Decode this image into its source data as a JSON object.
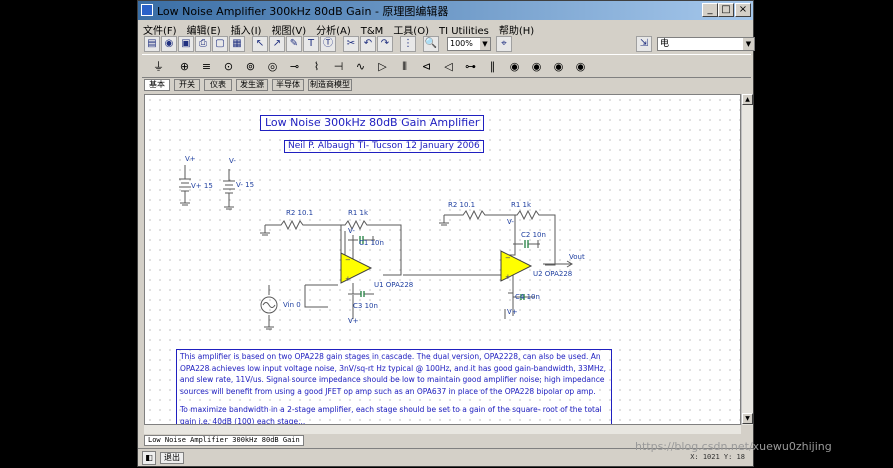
{
  "window": {
    "title": "Low Noise Amplifier 300kHz 80dB Gain - 原理图编辑器",
    "controls": {
      "minimize": "_",
      "maximize": "□",
      "close": "×"
    }
  },
  "menu": [
    "文件(F)",
    "编辑(E)",
    "插入(I)",
    "视图(V)",
    "分析(A)",
    "T&M",
    "工具(O)",
    "TI Utilities",
    "帮助(H)"
  ],
  "toolbar": {
    "zoom": "100%",
    "component_combo": "电"
  },
  "component_tabs": [
    "基本",
    "开关",
    "仪表",
    "发生源",
    "半导体",
    "制造商模型"
  ],
  "active_tab_index": 0,
  "schematic": {
    "title": "Low Noise 300kHz 80dB Gain Amplifier",
    "subtitle": "Neil P. Albaugh  TI- Tucson  12 January 2006",
    "labels": {
      "vplus_top": "V+",
      "vplus_src": "V+ 15",
      "vminus_top": "V-",
      "vminus_src": "V- 15",
      "r2": "R2 10.1",
      "r1": "R1 1k",
      "vminus1": "V-",
      "c1": "C1 10n",
      "u1": "U1 OPA228",
      "c3": "C3 10n",
      "vplus1": "V+",
      "vin": "Vin 0",
      "r2b": "R2 10.1",
      "r1b": "R1 1k",
      "vminus2": "V-",
      "c2": "C2 10n",
      "vout": "Vout",
      "u2": "U2 OPA228",
      "c4": "C4 10n",
      "vplus2": "V+"
    },
    "description": [
      "This amplifier is based on two OPA228 gain stages in cascade. The dual version, OPA2228, can also be used. An OPA228 achieves low input voltage noise, 3nV/sq-rt Hz typical @ 100Hz, and it has good gain-bandwidth, 33MHz, and slew rate, 11V/us. Signal source impedance should be low to maintain good amplifier noise; high impedance sources will benefit from using a good JFET op amp such as an OPA637 in place of the OPA228 bipolar op amp.",
      "To maximize bandwidth in a 2-stage amplifier, each stage should be set to a gain of the square- root of the total gain  i.e. 40dB (100) each stage..."
    ]
  },
  "document_tab": "Low Noise Amplifier 300kHz 80dB Gain",
  "status": {
    "button_label": "退出",
    "coords": "X: 1021  Y: 18"
  },
  "watermark": "https://blog.csdn.net/xuewu0zhijing",
  "colors": {
    "title_bar": "#3a6ea5",
    "wire": "#5a5a5a",
    "opamp_fill": "#ffff00",
    "text_blue": "#2020c0",
    "cap_green": "#208040"
  }
}
